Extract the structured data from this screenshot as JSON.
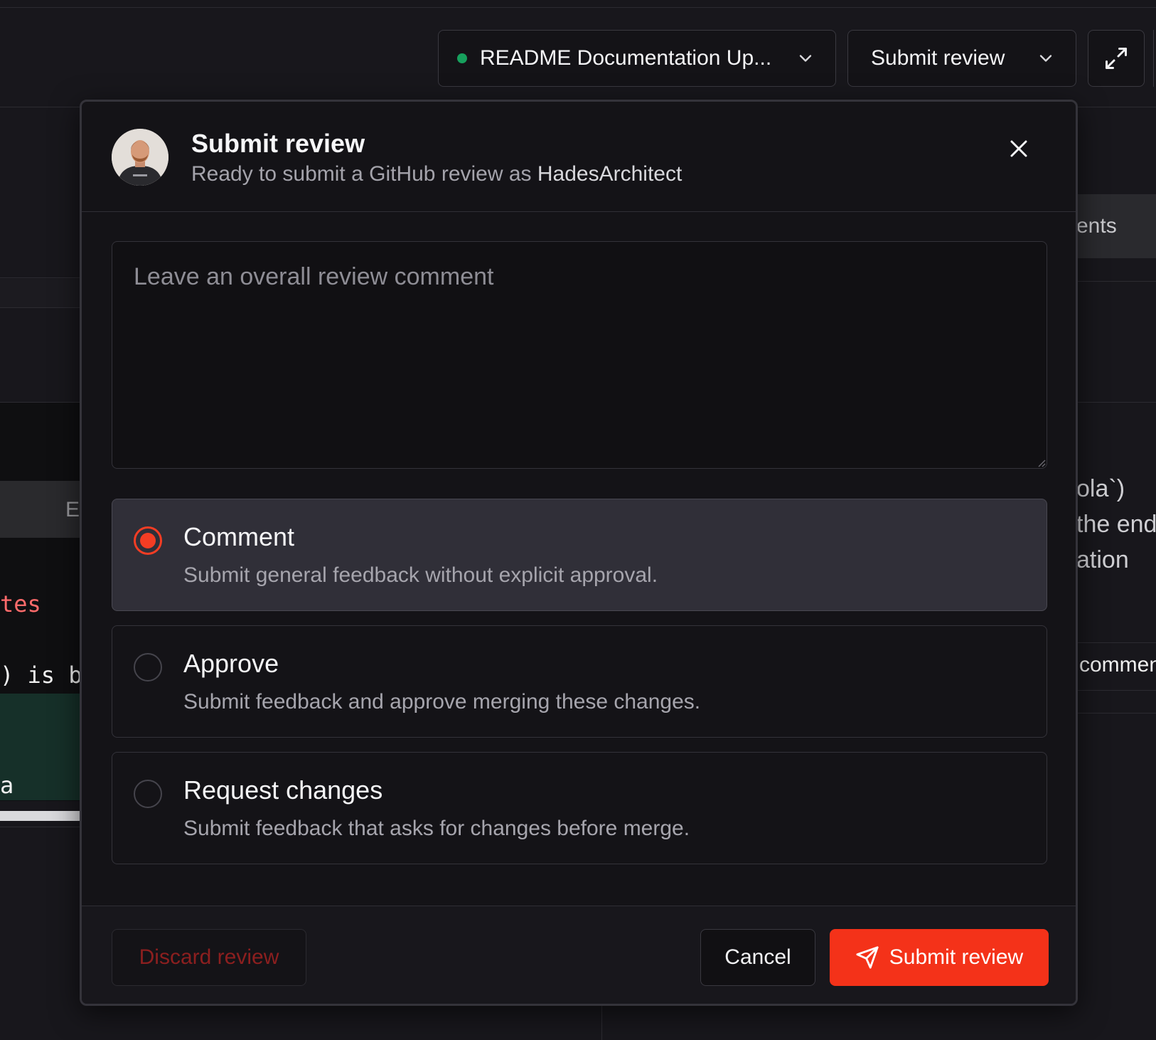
{
  "toolbar": {
    "pr_select_label": "README Documentation Up...",
    "pr_status_color": "#17a05d",
    "submit_select_label": "Submit review",
    "expand_icon": "expand-icon"
  },
  "background": {
    "right_tab_label": "ents",
    "right_text_lines": [
      "ola`)",
      "the end",
      "ation"
    ],
    "right_comment_label": "commen",
    "left_gray_label": "E",
    "left_red_code": "tes",
    "left_code_text": "is ba",
    "left_green_code": "a"
  },
  "modal": {
    "title": "Submit review",
    "subtitle_prefix": "Ready to submit a GitHub review as ",
    "username": "HadesArchitect",
    "avatar_icon": "user-avatar",
    "close_icon": "close-icon",
    "comment_placeholder": "Leave an overall review comment",
    "comment_value": "",
    "options": [
      {
        "title": "Comment",
        "description": "Submit general feedback without explicit approval.",
        "selected": true
      },
      {
        "title": "Approve",
        "description": "Submit feedback and approve merging these changes.",
        "selected": false
      },
      {
        "title": "Request changes",
        "description": "Submit feedback that asks for changes before merge.",
        "selected": false
      }
    ],
    "footer": {
      "discard_label": "Discard review",
      "cancel_label": "Cancel",
      "submit_label": "Submit review",
      "submit_icon": "send-icon"
    }
  },
  "colors": {
    "accent": "#f43219",
    "radio_selected": "#f43d24",
    "discard_text": "#8c1f1f"
  }
}
